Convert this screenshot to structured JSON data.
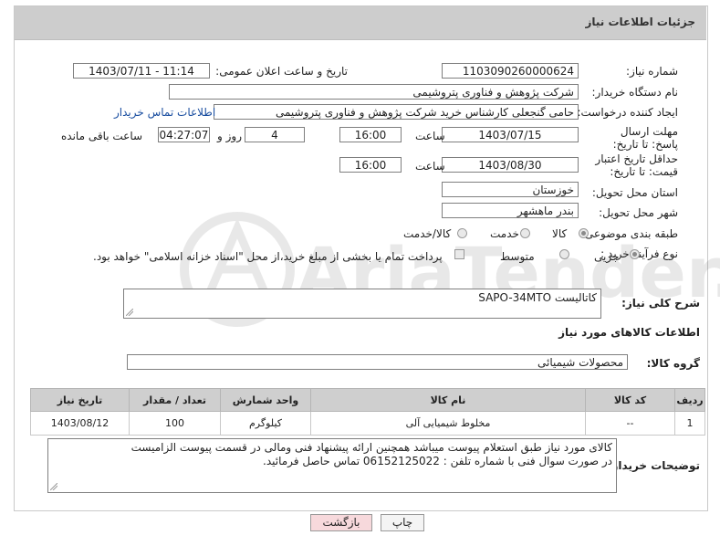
{
  "header": {
    "title": "جزئیات اطلاعات نیاز"
  },
  "fields": {
    "need_number_label": "شماره نیاز:",
    "need_number": "1103090260000624",
    "announce_label": "تاریخ و ساعت اعلان عمومی:",
    "announce_value": "1403/07/11 - 11:14",
    "buyer_label": "نام دستگاه خریدار:",
    "buyer_value": "شرکت پژوهش و فناوری پتروشیمی",
    "creator_label": "ایجاد کننده درخواست:",
    "creator_value": "حامی گنجعلی کارشناس خرید شرکت پژوهش و فناوری پتروشیمی",
    "contact_link": "اطلاعات تماس خریدار",
    "deadline_label": "مهلت ارسال پاسخ: تا تاریخ:",
    "deadline_date": "1403/07/15",
    "time_label": "ساعت",
    "deadline_time": "16:00",
    "days_value": "4",
    "days_label": "روز و",
    "remaining_time": "04:27:07",
    "remaining_label": "ساعت باقی مانده",
    "validity_label": "حداقل تاریخ اعتبار قیمت: تا تاریخ:",
    "validity_date": "1403/08/30",
    "validity_time": "16:00",
    "province_label": "استان محل تحویل:",
    "province_value": "خوزستان",
    "city_label": "شهر محل تحویل:",
    "city_value": "بندر ماهشهر",
    "category_label": "طبقه بندی موضوعی:",
    "category_options": [
      "کالا",
      "خدمت",
      "کالا/خدمت"
    ],
    "process_label": "نوع فرآیند خرید :",
    "process_options": [
      "جزیی",
      "متوسط"
    ],
    "payment_note": "پرداخت تمام یا بخشی از مبلغ خرید،از محل \"اسناد خزانه اسلامی\" خواهد بود.",
    "description_label": "شرح کلی نیاز:",
    "description_value": "کاتالیست SAPO-34MTO",
    "goods_info_title": "اطلاعات کالاهای مورد نیاز",
    "goods_group_label": "گروه کالا:",
    "goods_group_value": "محصولات شیمیائی",
    "buyer_notes_label": "توضیحات خریدار:",
    "buyer_notes_line1": "کالای مورد نیاز طبق استعلام پیوست میباشد همچنین ارائه پیشنهاد فنی ومالی در قسمت پیوست الزامیست",
    "buyer_notes_line2": "در صورت سوال فنی با شماره تلفن : 06152125022 تماس حاصل فرمائید."
  },
  "table": {
    "headers": [
      "ردیف",
      "کد کالا",
      "نام کالا",
      "واحد شمارش",
      "تعداد / مقدار",
      "تاریخ نیاز"
    ],
    "rows": [
      [
        "1",
        "--",
        "مخلوط شیمیایی آلی",
        "کیلوگرم",
        "100",
        "1403/08/12"
      ]
    ]
  },
  "buttons": {
    "print": "چاپ",
    "back": "بازگشت"
  },
  "watermark": {
    "text": "AriaTender.neT"
  },
  "colors": {
    "header_bg": "#cdcdcd",
    "link": "#1a4ea0",
    "back_button_bg": "#f7d9dc"
  }
}
